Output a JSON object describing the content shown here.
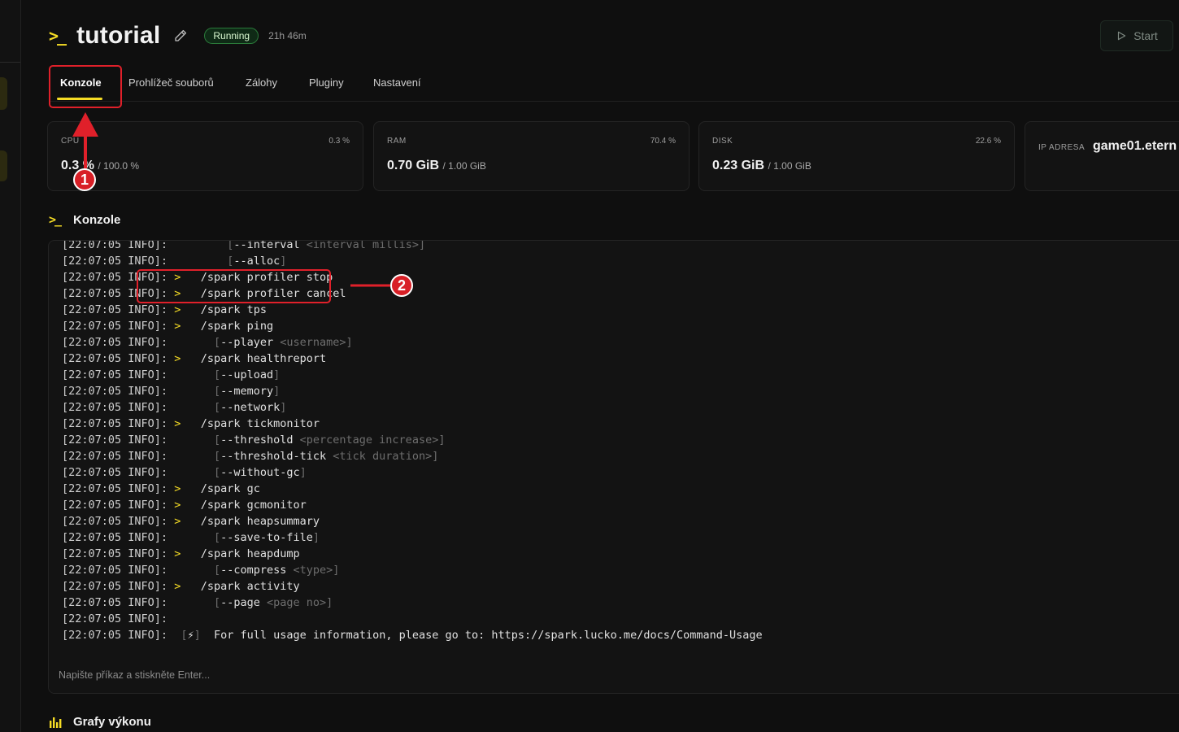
{
  "header": {
    "title": "tutorial",
    "status": "Running",
    "uptime": "21h 46m",
    "start_label": "Start"
  },
  "tabs": [
    {
      "label": "Konzole"
    },
    {
      "label": "Prohlížeč souborů"
    },
    {
      "label": "Zálohy"
    },
    {
      "label": "Pluginy"
    },
    {
      "label": "Nastavení"
    }
  ],
  "stats": {
    "cpu": {
      "label": "CPU",
      "value": "0.3 %",
      "total": "/ 100.0 %",
      "percent": "0.3 %"
    },
    "ram": {
      "label": "RAM",
      "value": "0.70 GiB",
      "total": "/ 1.00 GiB",
      "percent": "70.4 %"
    },
    "disk": {
      "label": "DISK",
      "value": "0.23 GiB",
      "total": "/ 1.00 GiB",
      "percent": "22.6 %"
    },
    "ip": {
      "label": "IP ADRESA",
      "value": "game01.etern"
    }
  },
  "console": {
    "title": "Konzole",
    "input_placeholder": "Napište příkaz a stiskněte Enter...",
    "lines": [
      {
        "ts": "[22:07:05 INFO]:",
        "gt": "",
        "indent": "       ",
        "open": "[",
        "arg": "--interval",
        "ph": " <interval millis>",
        "close": "]",
        "cmd": ""
      },
      {
        "ts": "[22:07:05 INFO]:",
        "gt": "",
        "indent": "       ",
        "open": "[",
        "arg": "--alloc",
        "ph": "",
        "close": "]",
        "cmd": ""
      },
      {
        "ts": "[22:07:05 INFO]:",
        "gt": ">",
        "indent": "",
        "open": "",
        "arg": "",
        "ph": "",
        "close": "",
        "cmd": "/spark profiler stop"
      },
      {
        "ts": "[22:07:05 INFO]:",
        "gt": ">",
        "indent": "",
        "open": "",
        "arg": "",
        "ph": "",
        "close": "",
        "cmd": "/spark profiler cancel"
      },
      {
        "ts": "[22:07:05 INFO]:",
        "gt": ">",
        "indent": "",
        "open": "",
        "arg": "",
        "ph": "",
        "close": "",
        "cmd": "/spark tps"
      },
      {
        "ts": "[22:07:05 INFO]:",
        "gt": ">",
        "indent": "",
        "open": "",
        "arg": "",
        "ph": "",
        "close": "",
        "cmd": "/spark ping"
      },
      {
        "ts": "[22:07:05 INFO]:",
        "gt": "",
        "indent": "     ",
        "open": "[",
        "arg": "--player",
        "ph": " <username>",
        "close": "]",
        "cmd": ""
      },
      {
        "ts": "[22:07:05 INFO]:",
        "gt": ">",
        "indent": "",
        "open": "",
        "arg": "",
        "ph": "",
        "close": "",
        "cmd": "/spark healthreport"
      },
      {
        "ts": "[22:07:05 INFO]:",
        "gt": "",
        "indent": "     ",
        "open": "[",
        "arg": "--upload",
        "ph": "",
        "close": "]",
        "cmd": ""
      },
      {
        "ts": "[22:07:05 INFO]:",
        "gt": "",
        "indent": "     ",
        "open": "[",
        "arg": "--memory",
        "ph": "",
        "close": "]",
        "cmd": ""
      },
      {
        "ts": "[22:07:05 INFO]:",
        "gt": "",
        "indent": "     ",
        "open": "[",
        "arg": "--network",
        "ph": "",
        "close": "]",
        "cmd": ""
      },
      {
        "ts": "[22:07:05 INFO]:",
        "gt": ">",
        "indent": "",
        "open": "",
        "arg": "",
        "ph": "",
        "close": "",
        "cmd": "/spark tickmonitor"
      },
      {
        "ts": "[22:07:05 INFO]:",
        "gt": "",
        "indent": "     ",
        "open": "[",
        "arg": "--threshold",
        "ph": " <percentage increase>",
        "close": "]",
        "cmd": ""
      },
      {
        "ts": "[22:07:05 INFO]:",
        "gt": "",
        "indent": "     ",
        "open": "[",
        "arg": "--threshold-tick",
        "ph": " <tick duration>",
        "close": "]",
        "cmd": ""
      },
      {
        "ts": "[22:07:05 INFO]:",
        "gt": "",
        "indent": "     ",
        "open": "[",
        "arg": "--without-gc",
        "ph": "",
        "close": "]",
        "cmd": ""
      },
      {
        "ts": "[22:07:05 INFO]:",
        "gt": ">",
        "indent": "",
        "open": "",
        "arg": "",
        "ph": "",
        "close": "",
        "cmd": "/spark gc"
      },
      {
        "ts": "[22:07:05 INFO]:",
        "gt": ">",
        "indent": "",
        "open": "",
        "arg": "",
        "ph": "",
        "close": "",
        "cmd": "/spark gcmonitor"
      },
      {
        "ts": "[22:07:05 INFO]:",
        "gt": ">",
        "indent": "",
        "open": "",
        "arg": "",
        "ph": "",
        "close": "",
        "cmd": "/spark heapsummary"
      },
      {
        "ts": "[22:07:05 INFO]:",
        "gt": "",
        "indent": "     ",
        "open": "[",
        "arg": "--save-to-file",
        "ph": "",
        "close": "]",
        "cmd": ""
      },
      {
        "ts": "[22:07:05 INFO]:",
        "gt": ">",
        "indent": "",
        "open": "",
        "arg": "",
        "ph": "",
        "close": "",
        "cmd": "/spark heapdump"
      },
      {
        "ts": "[22:07:05 INFO]:",
        "gt": "",
        "indent": "     ",
        "open": "[",
        "arg": "--compress",
        "ph": " <type>",
        "close": "]",
        "cmd": ""
      },
      {
        "ts": "[22:07:05 INFO]:",
        "gt": ">",
        "indent": "",
        "open": "",
        "arg": "",
        "ph": "",
        "close": "",
        "cmd": "/spark activity"
      },
      {
        "ts": "[22:07:05 INFO]:",
        "gt": "",
        "indent": "     ",
        "open": "[",
        "arg": "--page",
        "ph": " <page no>",
        "close": "]",
        "cmd": ""
      },
      {
        "ts": "[22:07:05 INFO]:",
        "gt": "",
        "indent": "",
        "open": "",
        "arg": "",
        "ph": "",
        "close": "",
        "cmd": ""
      },
      {
        "ts": "[22:07:05 INFO]:",
        "gt": "",
        "indent": "",
        "open": "[",
        "arg": "⚡",
        "ph": "",
        "close": "]",
        "cmd": " For full usage information, please go to: https://spark.lucko.me/docs/Command-Usage"
      }
    ]
  },
  "performance": {
    "title": "Grafy výkonu"
  },
  "annotations": [
    {
      "number": "1"
    },
    {
      "number": "2"
    }
  ],
  "colors": {
    "accent": "#f5dc25",
    "running": "#2a7a3a",
    "annotation": "#e0202a"
  }
}
